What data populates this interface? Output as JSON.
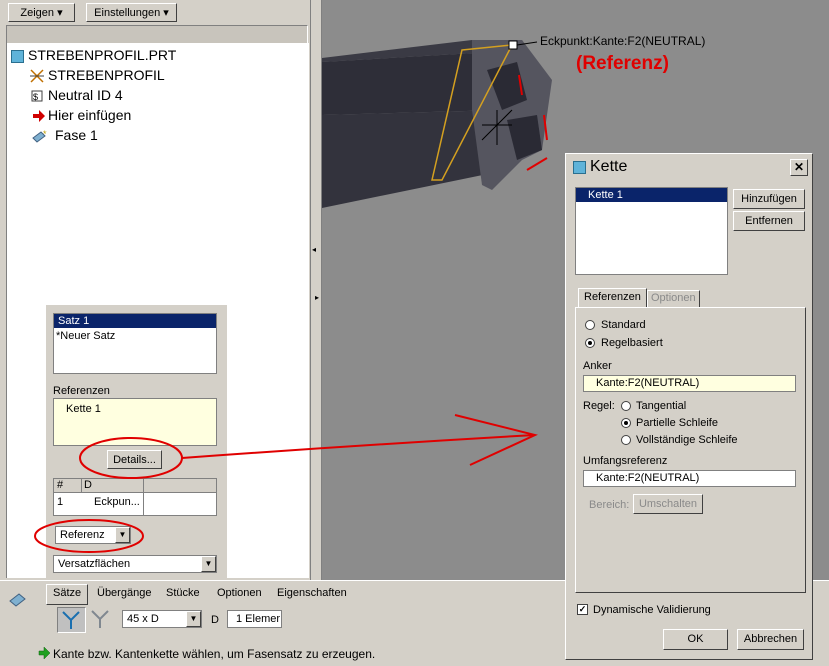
{
  "toolbar": {
    "show_label": "Zeigen ▾",
    "settings_label": "Einstellungen ▾"
  },
  "tree": {
    "items": [
      {
        "label": "STREBENPROFIL.PRT",
        "icon": "part-icon"
      },
      {
        "label": "STREBENPROFIL",
        "icon": "feature-icon"
      },
      {
        "label": "Neutral ID 4",
        "icon": "neutral-icon"
      },
      {
        "label": "Hier einfügen",
        "icon": "insert-arrow-icon"
      },
      {
        "label": "Fase 1",
        "icon": "chamfer-icon"
      }
    ]
  },
  "viewport": {
    "vertex_label": "Eckpunkt:Kante:F2(NEUTRAL)",
    "annotation": "(Referenz)"
  },
  "sets_panel": {
    "sets": [
      "Satz 1",
      "*Neuer Satz"
    ],
    "references_heading": "Referenzen",
    "references": [
      "Kette 1"
    ],
    "details_button": "Details...",
    "table_headers": [
      "#",
      "D"
    ],
    "table_rows": [
      [
        "1",
        "Eckpun..."
      ]
    ],
    "reference_select": "Referenz",
    "offset_select": "Versatzflächen"
  },
  "dashboard": {
    "tabs": [
      "Sätze",
      "Übergänge",
      "Stücke",
      "Optionen",
      "Eigenschaften"
    ],
    "dim_scheme": "45 x D",
    "d_label": "D",
    "d_value": "1 Elemer",
    "message": "Kante bzw. Kantenkette wählen, um Fasensatz zu erzeugen."
  },
  "dialog": {
    "title": "Kette",
    "chains": [
      "Kette 1"
    ],
    "add_button": "Hinzufügen",
    "remove_button": "Entfernen",
    "tabs": [
      "Referenzen",
      "Optionen"
    ],
    "type_standard": "Standard",
    "type_rule": "Regelbasiert",
    "anchor_label": "Anker",
    "anchor_value": "Kante:F2(NEUTRAL)",
    "rule_label": "Regel:",
    "rules": [
      "Tangential",
      "Partielle Schleife",
      "Vollständige Schleife"
    ],
    "extent_label": "Umfangsreferenz",
    "extent_value": "Kante:F2(NEUTRAL)",
    "range_label": "Bereich:",
    "toggle_button": "Umschalten",
    "dynamic_validation": "Dynamische Validierung",
    "ok_button": "OK",
    "cancel_button": "Abbrechen"
  },
  "colors": {
    "selection": "#0a246a",
    "annotation_red": "#e00000",
    "window_bg": "#d4d0c8",
    "field_yellow": "#ffffe0"
  }
}
